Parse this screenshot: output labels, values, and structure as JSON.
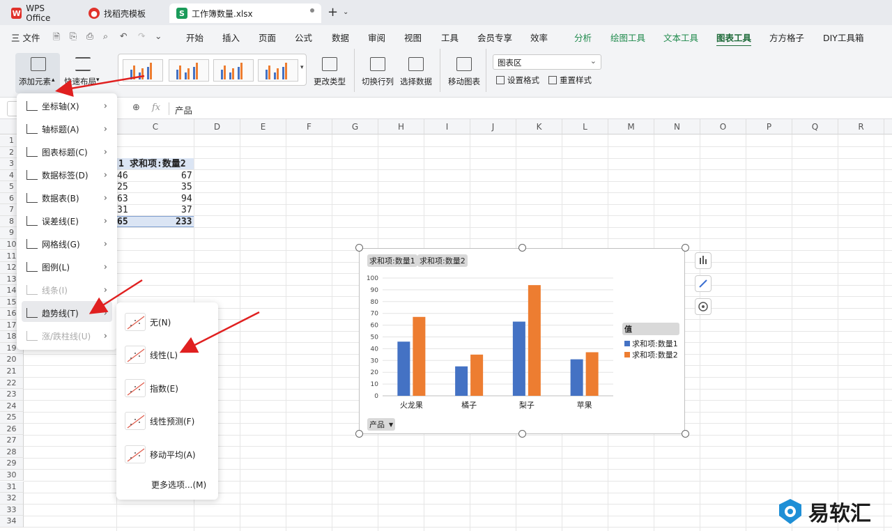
{
  "tabs": [
    {
      "label": "WPS Office",
      "icon": "wps-logo-icon"
    },
    {
      "label": "找稻壳模板",
      "icon": "docer-icon"
    },
    {
      "label": "工作簿数量.xlsx",
      "icon": "spreadsheet-icon"
    }
  ],
  "menubar": {
    "file": "三 文件",
    "items": [
      "开始",
      "插入",
      "页面",
      "公式",
      "数据",
      "审阅",
      "视图",
      "工具",
      "会员专享",
      "效率",
      "分析",
      "绘图工具",
      "文本工具",
      "图表工具",
      "方方格子",
      "DIY工具箱"
    ],
    "active": "图表工具"
  },
  "ribbon": {
    "add_element": "添加元素",
    "quick_layout": "快速布局",
    "change_type": "更改类型",
    "switch_row_col": "切换行列",
    "select_data": "选择数据",
    "move_chart": "移动图表",
    "chart_area_select": "图表区",
    "set_format": "设置格式",
    "reset_style": "重置样式"
  },
  "formula_bar": {
    "value": "产品"
  },
  "columns": [
    "C",
    "D",
    "E",
    "F",
    "G",
    "H",
    "I",
    "J",
    "K",
    "L",
    "M",
    "N",
    "O",
    "P",
    "Q",
    "R"
  ],
  "rows": [
    "1",
    "2",
    "3",
    "4",
    "5",
    "6",
    "7",
    "8",
    "9",
    "10",
    "11",
    "12",
    "13",
    "14",
    "15",
    "16",
    "17",
    "18",
    "19",
    "20",
    "21",
    "22",
    "23",
    "24",
    "25",
    "26",
    "27",
    "28",
    "29",
    "30",
    "31",
    "32",
    "33",
    "34"
  ],
  "cells": {
    "header_b": "1",
    "header_c": "求和项:数量2",
    "b": [
      "46",
      "25",
      "63",
      "31",
      "65"
    ],
    "c": [
      "67",
      "35",
      "94",
      "37",
      "233"
    ]
  },
  "add_element_menu": [
    {
      "label": "坐标轴(X)",
      "enabled": true
    },
    {
      "label": "轴标题(A)",
      "enabled": true
    },
    {
      "label": "图表标题(C)",
      "enabled": true
    },
    {
      "label": "数据标签(D)",
      "enabled": true
    },
    {
      "label": "数据表(B)",
      "enabled": true
    },
    {
      "label": "误差线(E)",
      "enabled": true
    },
    {
      "label": "网格线(G)",
      "enabled": true
    },
    {
      "label": "图例(L)",
      "enabled": true
    },
    {
      "label": "线条(I)",
      "enabled": false
    },
    {
      "label": "趋势线(T)",
      "enabled": true
    },
    {
      "label": "涨/跌柱线(U)",
      "enabled": false
    }
  ],
  "trendline_menu": {
    "items": [
      "无(N)",
      "线性(L)",
      "指数(E)",
      "线性预测(F)",
      "移动平均(A)"
    ],
    "more": "更多选项...(M)"
  },
  "chart_data": {
    "type": "bar",
    "categories": [
      "火龙果",
      "橘子",
      "梨子",
      "苹果"
    ],
    "series": [
      {
        "name": "求和项:数量1",
        "values": [
          46,
          25,
          63,
          31
        ],
        "color": "#4472c4"
      },
      {
        "name": "求和项:数量2",
        "values": [
          67,
          35,
          94,
          37
        ],
        "color": "#ed7d31"
      }
    ],
    "ylim": [
      0,
      100
    ],
    "yticks": [
      "0",
      "10",
      "20",
      "30",
      "40",
      "50",
      "60",
      "70",
      "80",
      "90",
      "100"
    ],
    "legend_title": "值",
    "legend_position": "right",
    "grid": true,
    "field_buttons": [
      "求和项:数量1",
      "求和项:数量2"
    ],
    "axis_field_button": "产品"
  },
  "watermark": {
    "text": "易软汇"
  }
}
